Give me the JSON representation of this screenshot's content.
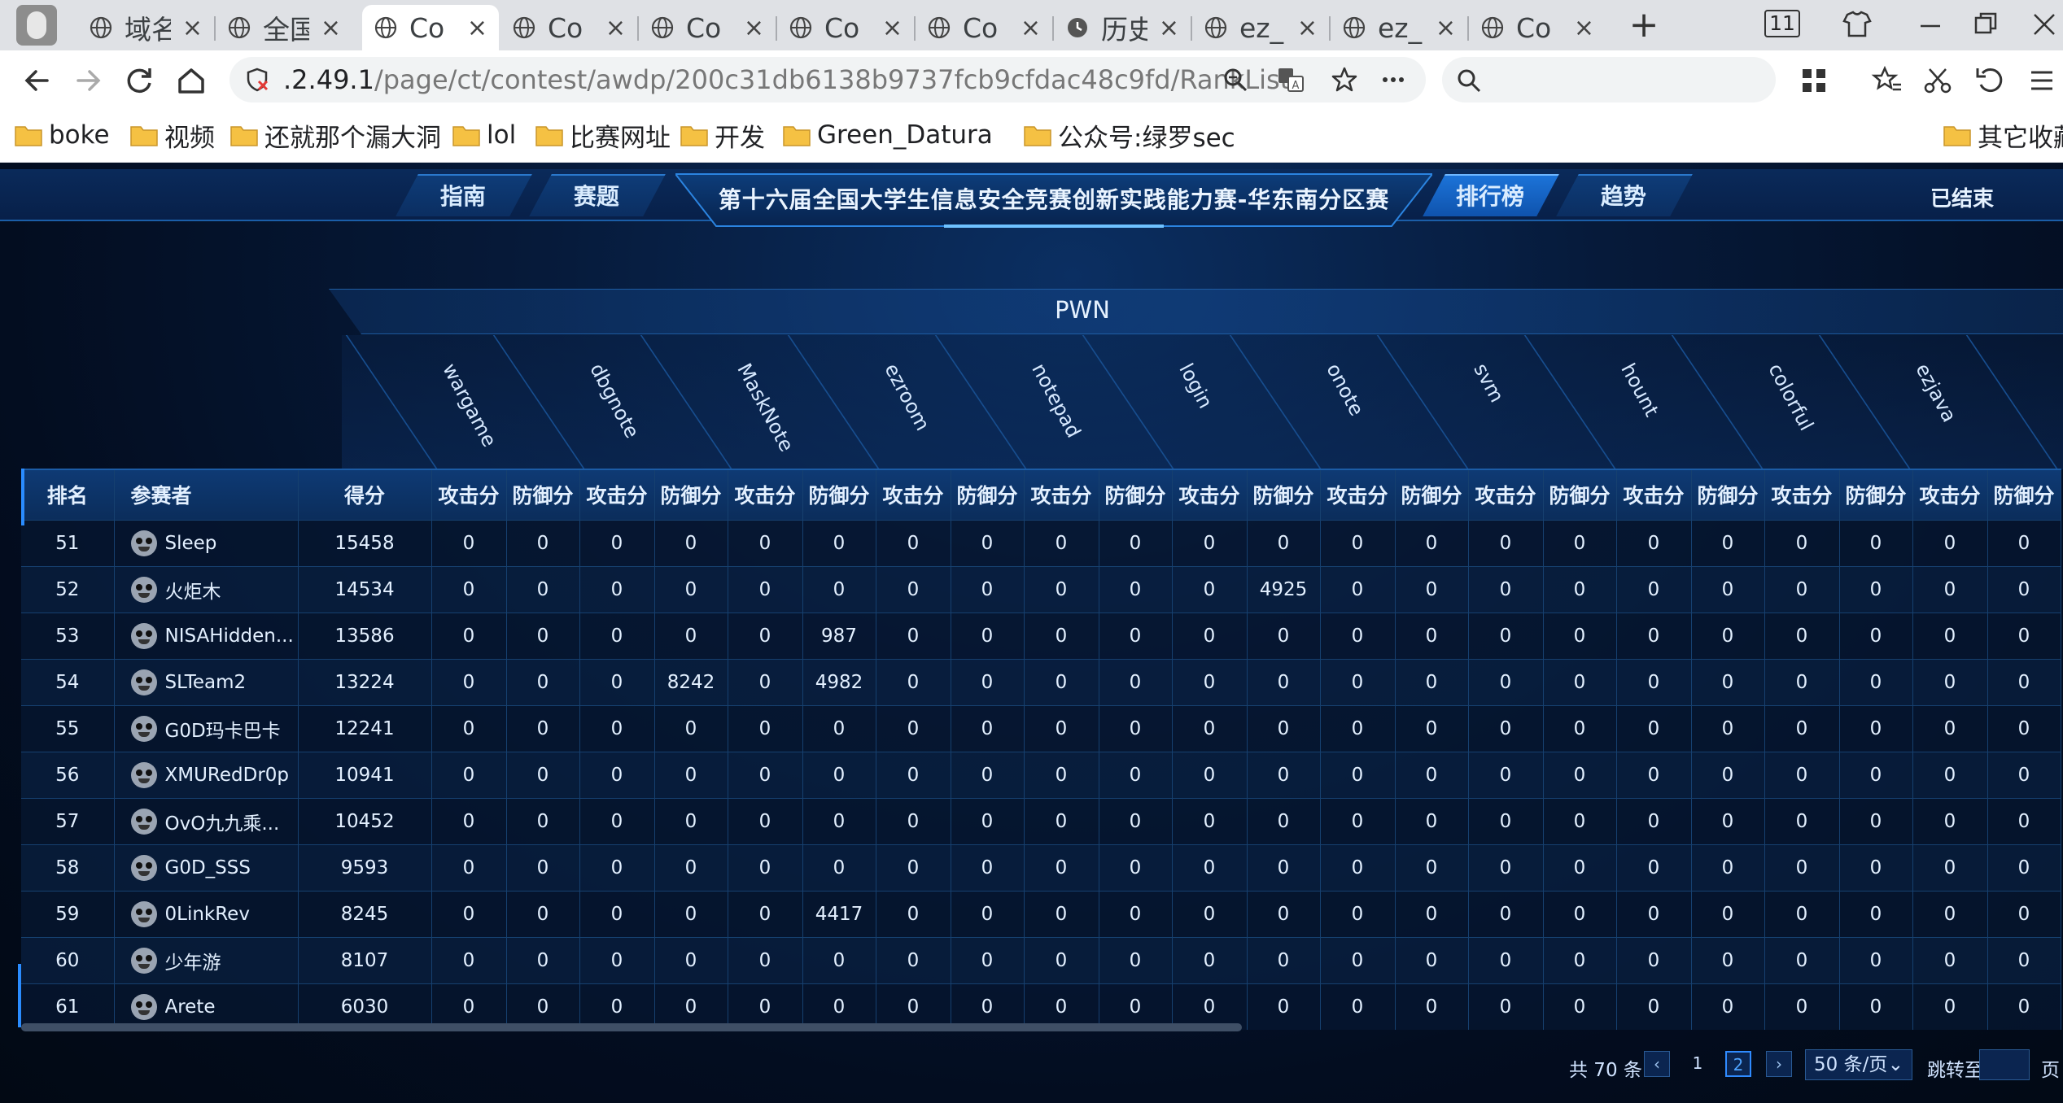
{
  "browser": {
    "tabs": [
      {
        "label": "域名"
      },
      {
        "label": "全国"
      },
      {
        "label": "Co"
      },
      {
        "label": "Co"
      },
      {
        "label": "Co"
      },
      {
        "label": "Co"
      },
      {
        "label": "Co"
      },
      {
        "label": "历史"
      },
      {
        "label": "ez_"
      },
      {
        "label": "ez_"
      },
      {
        "label": "Co"
      }
    ],
    "active_tab": 2,
    "tab_count": "11",
    "url_host": ".2.49.1",
    "url_path": "/page/ct/contest/awdp/200c31db6138b9737fcb9cfdac48c9fd/RankList",
    "bookmarks": [
      "boke",
      "视频",
      "还就那个漏大洞",
      "lol",
      "比赛网址",
      "开发",
      "Green_Datura",
      "公众号:绿罗sec",
      "其它收藏"
    ]
  },
  "header": {
    "tabs_left": [
      "指南",
      "赛题"
    ],
    "title": "第十六届全国大学生信息安全竞赛创新实践能力赛-华东南分区赛",
    "tabs_right": [
      "排行榜",
      "趋势"
    ],
    "active_tab": "排行榜",
    "status": "已结束"
  },
  "category": "PWN",
  "challenges": [
    "wargame",
    "dbgnote",
    "MaskNote",
    "ezroom",
    "notepad",
    "login",
    "onote",
    "svm",
    "hount",
    "colorful",
    "ezjava"
  ],
  "table": {
    "col_rank": "排名",
    "col_player": "参赛者",
    "col_score": "得分",
    "col_attack": "攻击分",
    "col_defense": "防御分",
    "rows": [
      {
        "rank": "51",
        "name": "Sleep",
        "score": "15458",
        "cells": [
          "0",
          "0",
          "0",
          "0",
          "0",
          "0",
          "0",
          "0",
          "0",
          "0",
          "0",
          "0",
          "0",
          "0",
          "0",
          "0",
          "0",
          "0",
          "0",
          "0",
          "0",
          "0"
        ]
      },
      {
        "rank": "52",
        "name": "火炬木",
        "score": "14534",
        "cells": [
          "0",
          "0",
          "0",
          "0",
          "0",
          "0",
          "0",
          "0",
          "0",
          "0",
          "0",
          "4925",
          "0",
          "0",
          "0",
          "0",
          "0",
          "0",
          "0",
          "0",
          "0",
          "0"
        ]
      },
      {
        "rank": "53",
        "name": "NISAHidden...",
        "score": "13586",
        "cells": [
          "0",
          "0",
          "0",
          "0",
          "0",
          "987",
          "0",
          "0",
          "0",
          "0",
          "0",
          "0",
          "0",
          "0",
          "0",
          "0",
          "0",
          "0",
          "0",
          "0",
          "0",
          "0"
        ]
      },
      {
        "rank": "54",
        "name": "SLTeam2",
        "score": "13224",
        "cells": [
          "0",
          "0",
          "0",
          "8242",
          "0",
          "4982",
          "0",
          "0",
          "0",
          "0",
          "0",
          "0",
          "0",
          "0",
          "0",
          "0",
          "0",
          "0",
          "0",
          "0",
          "0",
          "0"
        ]
      },
      {
        "rank": "55",
        "name": "G0D玛卡巴卡",
        "score": "12241",
        "cells": [
          "0",
          "0",
          "0",
          "0",
          "0",
          "0",
          "0",
          "0",
          "0",
          "0",
          "0",
          "0",
          "0",
          "0",
          "0",
          "0",
          "0",
          "0",
          "0",
          "0",
          "0",
          "0"
        ]
      },
      {
        "rank": "56",
        "name": "XMURedDr0p",
        "score": "10941",
        "cells": [
          "0",
          "0",
          "0",
          "0",
          "0",
          "0",
          "0",
          "0",
          "0",
          "0",
          "0",
          "0",
          "0",
          "0",
          "0",
          "0",
          "0",
          "0",
          "0",
          "0",
          "0",
          "0"
        ]
      },
      {
        "rank": "57",
        "name": "OvO九九乘...",
        "score": "10452",
        "cells": [
          "0",
          "0",
          "0",
          "0",
          "0",
          "0",
          "0",
          "0",
          "0",
          "0",
          "0",
          "0",
          "0",
          "0",
          "0",
          "0",
          "0",
          "0",
          "0",
          "0",
          "0",
          "0"
        ]
      },
      {
        "rank": "58",
        "name": "G0D_SSS",
        "score": "9593",
        "cells": [
          "0",
          "0",
          "0",
          "0",
          "0",
          "0",
          "0",
          "0",
          "0",
          "0",
          "0",
          "0",
          "0",
          "0",
          "0",
          "0",
          "0",
          "0",
          "0",
          "0",
          "0",
          "0"
        ]
      },
      {
        "rank": "59",
        "name": "0LinkRev",
        "score": "8245",
        "cells": [
          "0",
          "0",
          "0",
          "0",
          "0",
          "4417",
          "0",
          "0",
          "0",
          "0",
          "0",
          "0",
          "0",
          "0",
          "0",
          "0",
          "0",
          "0",
          "0",
          "0",
          "0",
          "0"
        ]
      },
      {
        "rank": "60",
        "name": "少年游",
        "score": "8107",
        "cells": [
          "0",
          "0",
          "0",
          "0",
          "0",
          "0",
          "0",
          "0",
          "0",
          "0",
          "0",
          "0",
          "0",
          "0",
          "0",
          "0",
          "0",
          "0",
          "0",
          "0",
          "0",
          "0"
        ]
      },
      {
        "rank": "61",
        "name": "Arete",
        "score": "6030",
        "cells": [
          "0",
          "0",
          "0",
          "0",
          "0",
          "0",
          "0",
          "0",
          "0",
          "0",
          "0",
          "0",
          "0",
          "0",
          "0",
          "0",
          "0",
          "0",
          "0",
          "0",
          "0",
          "0"
        ]
      }
    ]
  },
  "pagination": {
    "total": "共 70 条",
    "pages": [
      "1",
      "2"
    ],
    "current": "2",
    "page_size": "50 条/页",
    "jump_label": "跳转至",
    "jump_suffix": "页"
  },
  "icons": {
    "back": "back-arrow-icon",
    "forward": "forward-arrow-icon",
    "reload": "reload-icon",
    "home": "home-icon",
    "shield": "shield-icon",
    "zoom": "zoom-icon",
    "translate": "translate-icon",
    "star": "star-icon",
    "more": "more-icon",
    "search": "search-icon",
    "apps": "apps-icon",
    "favorites": "favorites-icon",
    "cut": "scissors-icon",
    "undo": "undo-icon",
    "menu": "menu-icon",
    "folder": "folder-icon",
    "globe": "globe-icon",
    "history": "clock-icon"
  },
  "colors": {
    "accent": "#2f8bff",
    "folder": "#f5c143",
    "page_bg": "#041530"
  }
}
